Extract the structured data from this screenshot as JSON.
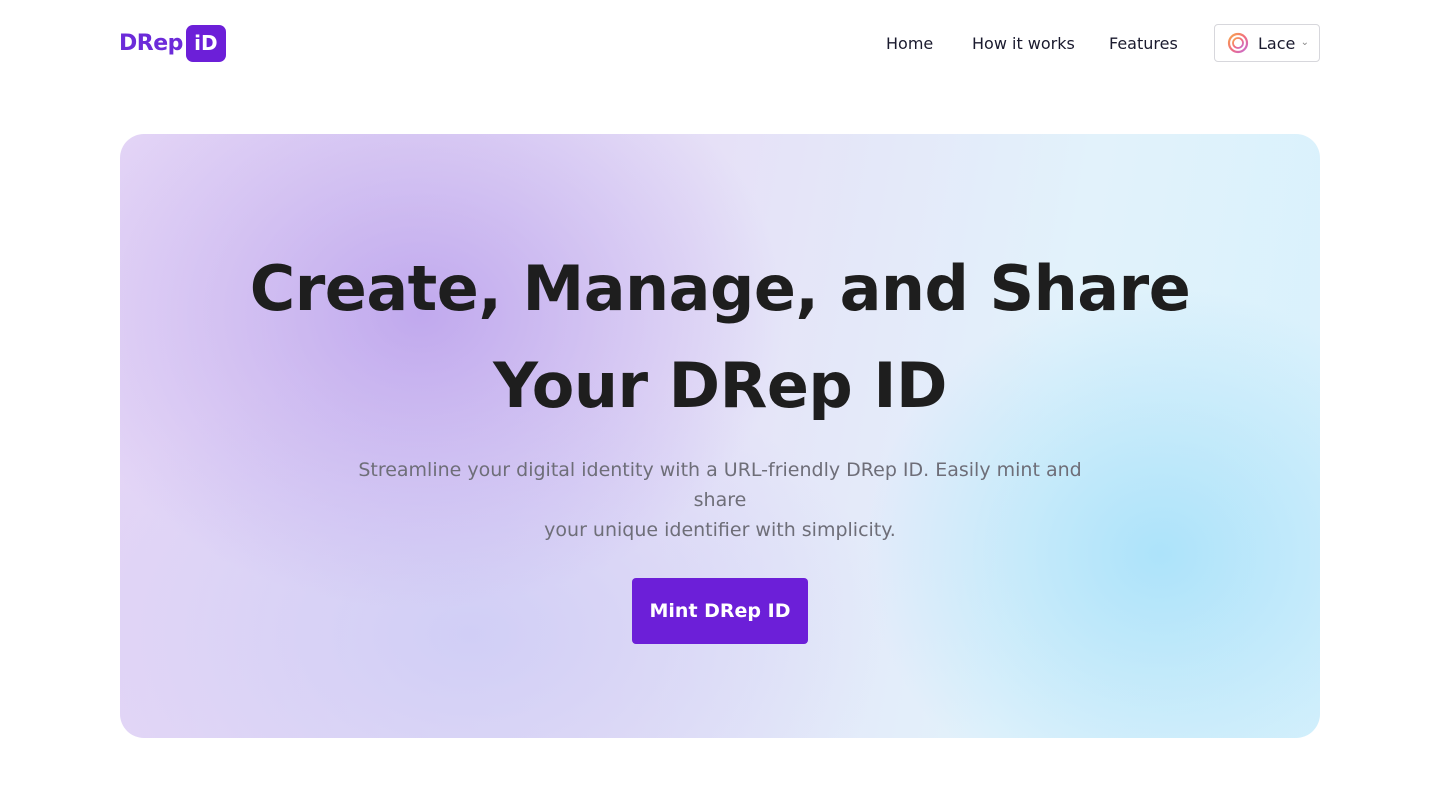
{
  "brand": {
    "logo_text": "DRep",
    "logo_badge": "iD",
    "accent_color": "#6c1fd8"
  },
  "nav": {
    "items": [
      {
        "label": "Home"
      },
      {
        "label": "How it works"
      },
      {
        "label": "Features"
      }
    ],
    "wallet": {
      "label": "Lace",
      "icon": "lace-wallet-icon",
      "dropdown_icon": "chevron-down-icon"
    }
  },
  "hero": {
    "title_line1": "Create, Manage, and Share",
    "title_line2": "Your DRep ID",
    "subtitle_line1": "Streamline your digital identity with a URL-friendly DRep ID. Easily mint and share",
    "subtitle_line2": "your unique identifier with simplicity.",
    "cta_label": "Mint DRep ID"
  }
}
